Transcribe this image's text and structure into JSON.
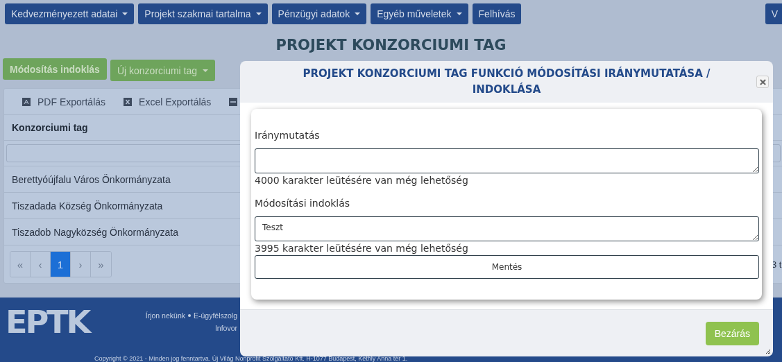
{
  "nav": {
    "buttons": [
      {
        "label": "Kedvezményezett adatai",
        "dropdown": true
      },
      {
        "label": "Projekt szakmai tartalma",
        "dropdown": true
      },
      {
        "label": "Pénzügyi adatok",
        "dropdown": true
      },
      {
        "label": "Egyéb műveletek",
        "dropdown": true
      },
      {
        "label": "Felhívás",
        "dropdown": false
      }
    ],
    "right_button": "V"
  },
  "page_title": "PROJEKT KONZORCIUMI TAG",
  "actions": [
    {
      "label": "Módosítás indoklás",
      "dropdown": false
    },
    {
      "label": "Új konzorciumi tag",
      "dropdown": true
    }
  ],
  "toolbar": [
    {
      "kind": "pdf",
      "label": "PDF Exportálás"
    },
    {
      "kind": "excel",
      "label": "Excel Exportálás"
    },
    {
      "kind": "csv"
    }
  ],
  "table": {
    "columns": [
      "Konzorciumi tag"
    ],
    "rows": [
      "Berettyóújfalu Város Önkormányzata",
      "Tiszadada Község Önkormányzata",
      "Tiszadob Nagyközség Önkormányzata"
    ],
    "pagination": [
      {
        "label": "«",
        "selected": false,
        "disabled": true
      },
      {
        "label": "‹",
        "selected": false,
        "disabled": true
      },
      {
        "label": "1",
        "selected": true,
        "disabled": false
      },
      {
        "label": "›",
        "selected": false,
        "disabled": true
      },
      {
        "label": "»",
        "selected": false,
        "disabled": true
      }
    ],
    "count_text": "3 t"
  },
  "footer": {
    "logo": "EPTK",
    "links": [
      "Írjon nekünk",
      "E-ügyfélszolg"
    ],
    "line2": "Infovor",
    "copyright": "Copyright © 2021 - Minden jog fenntartva. Új Világ Nonprofit Szolgáltató Kft. H-1077 Budapest, Kéthly Anna tér 1."
  },
  "modal": {
    "title": "PROJEKT KONZORCIUMI TAG FUNKCIÓ MÓDOSÍTÁSI IRÁNYMUTATÁSA / INDOKLÁSA",
    "fields": [
      {
        "label": "Iránymutatás",
        "remaining": "4000 karakter leütésére van még lehetőség"
      },
      {
        "label": "Módosítási indoklás",
        "value": "Teszt",
        "remaining": "3995 karakter leütésére van még lehetőség"
      }
    ],
    "save_button": "Mentés",
    "close_button": "Bezárás"
  }
}
